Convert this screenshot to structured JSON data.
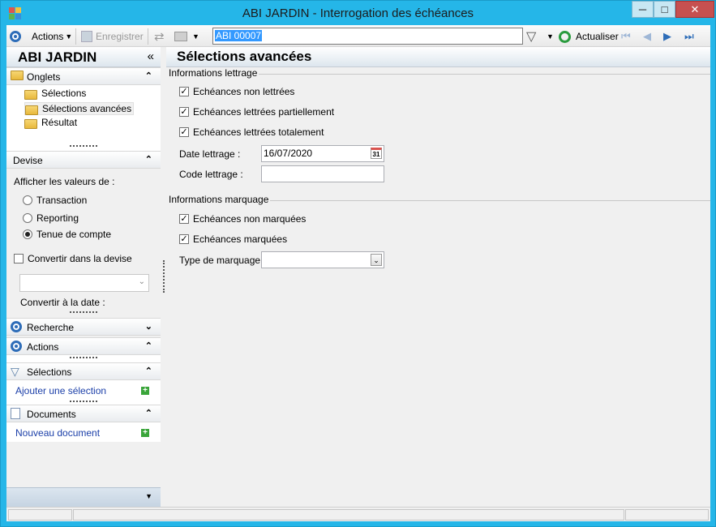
{
  "window": {
    "title": "ABI JARDIN -  Interrogation des échéances",
    "minimize": "─",
    "maximize": "□",
    "close": "✕"
  },
  "toolbar": {
    "actions_label": "Actions",
    "save_label": "Enregistrer",
    "search_value": "ABI 00007",
    "refresh_label": "Actualiser"
  },
  "sidebar": {
    "title": "ABI JARDIN",
    "collapse": "«",
    "tabs_section": "Onglets",
    "tabs": [
      "Sélections",
      "Sélections avancées",
      "Résultat"
    ],
    "devise": {
      "title": "Devise",
      "show_values_label": "Afficher les valeurs de :",
      "options": [
        "Transaction",
        "Reporting",
        "Tenue de compte"
      ],
      "selected": "Tenue de compte",
      "convert_label": "Convertir dans la devise",
      "convert_checked": false,
      "convert_date_label": "Convertir à la date :"
    },
    "recherche": "Recherche",
    "actions": "Actions",
    "selections": {
      "title": "Sélections",
      "add_link": "Ajouter une sélection"
    },
    "documents": {
      "title": "Documents",
      "new_link": "Nouveau document"
    }
  },
  "main": {
    "title": "Sélections avancées",
    "lettrage": {
      "group": "Informations lettrage",
      "checks": [
        {
          "label": "Echéances non lettrées",
          "checked": true
        },
        {
          "label": "Echéances lettrées partiellement",
          "checked": true
        },
        {
          "label": "Echéances lettrées totalement",
          "checked": true
        }
      ],
      "date_label": "Date lettrage :",
      "date_value": "16/07/2020",
      "calendar_day": "31",
      "code_label": "Code lettrage :",
      "code_value": ""
    },
    "marquage": {
      "group": "Informations marquage",
      "checks": [
        {
          "label": "Echéances non marquées",
          "checked": true
        },
        {
          "label": "Echéances marquées",
          "checked": true
        }
      ],
      "type_label": "Type de marquage :",
      "type_value": ""
    }
  },
  "colors": {
    "accent": "#25b6e8",
    "link": "#1a3ea8"
  }
}
